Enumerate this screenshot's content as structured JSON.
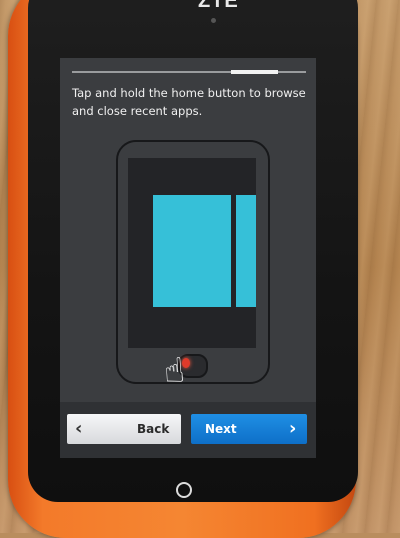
{
  "device": {
    "brand": "ZTE"
  },
  "tutorial": {
    "progress": 0.85,
    "instruction": "Tap and hold the home button to browse and close recent apps.",
    "illustration": {
      "highlight_color": "#36c0d8",
      "tap_indicator_color": "#e03a2a",
      "icon": "pointing-hand-icon"
    }
  },
  "buttons": {
    "back_label": "Back",
    "next_label": "Next",
    "back_icon": "chevron-left-icon",
    "next_icon": "chevron-right-icon",
    "next_color": "#1a86de"
  }
}
